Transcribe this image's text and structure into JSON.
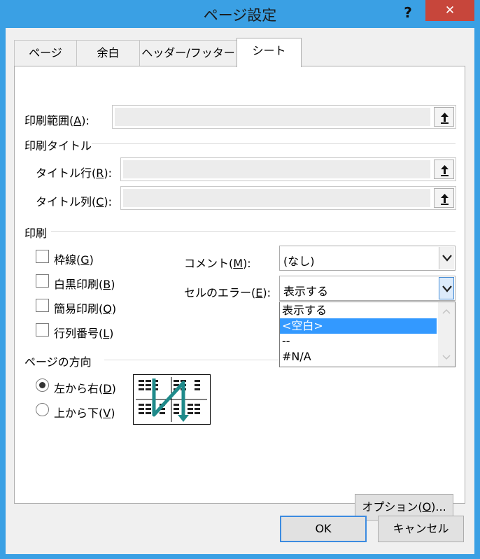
{
  "window": {
    "title": "ページ設定",
    "help_label": "?",
    "close_label": "✕"
  },
  "tabs": [
    {
      "label": "ページ",
      "active": false
    },
    {
      "label": "余白",
      "active": false
    },
    {
      "label": "ヘッダー/フッター",
      "active": false
    },
    {
      "label": "シート",
      "active": true
    }
  ],
  "print_area": {
    "label": "印刷範囲(",
    "key": "A",
    "label_end": "):",
    "value": ""
  },
  "print_titles": {
    "section_label": "印刷タイトル",
    "rows": {
      "label": "タイトル行(",
      "key": "R",
      "label_end": "):",
      "value": ""
    },
    "cols": {
      "label": "タイトル列(",
      "key": "C",
      "label_end": "):",
      "value": ""
    }
  },
  "print": {
    "section_label": "印刷",
    "gridlines": {
      "label": "枠線(",
      "key": "G",
      "label_end": ")",
      "checked": false
    },
    "black_white": {
      "label": "白黒印刷(",
      "key": "B",
      "label_end": ")",
      "checked": false
    },
    "draft": {
      "label": "簡易印刷(",
      "key": "Q",
      "label_end": ")",
      "checked": false
    },
    "headings": {
      "label": "行列番号(",
      "key": "L",
      "label_end": ")",
      "checked": false
    },
    "comments": {
      "label": "コメント(",
      "key": "M",
      "label_end": "):",
      "value": "(なし)"
    },
    "cell_errors": {
      "label": "セルのエラー(",
      "key": "E",
      "label_end": "):",
      "value": "表示する",
      "options": [
        "表示する",
        "<空白>",
        "--",
        "#N/A"
      ],
      "highlighted_index": 1
    }
  },
  "page_order": {
    "section_label": "ページの方向",
    "down_then_over": {
      "label": "左から右(",
      "key": "D",
      "label_end": ")",
      "selected": true
    },
    "over_then_down": {
      "label": "上から下(",
      "key": "V",
      "label_end": ")",
      "selected": false
    }
  },
  "buttons": {
    "options": {
      "label": "オプション(",
      "key": "O",
      "label_end": ")..."
    },
    "ok": "OK",
    "cancel": "キャンセル"
  },
  "colors": {
    "title_bar": "#3aa0e4",
    "close_button": "#c7463b",
    "selection": "#3399ff",
    "order_arrow": "#1f8a8a"
  },
  "icons": {
    "collapse": "collapse-dialog-icon",
    "combo_arrow": "chevron-down-icon",
    "scroll_up": "chevron-up-icon",
    "scroll_down": "chevron-down-icon"
  }
}
